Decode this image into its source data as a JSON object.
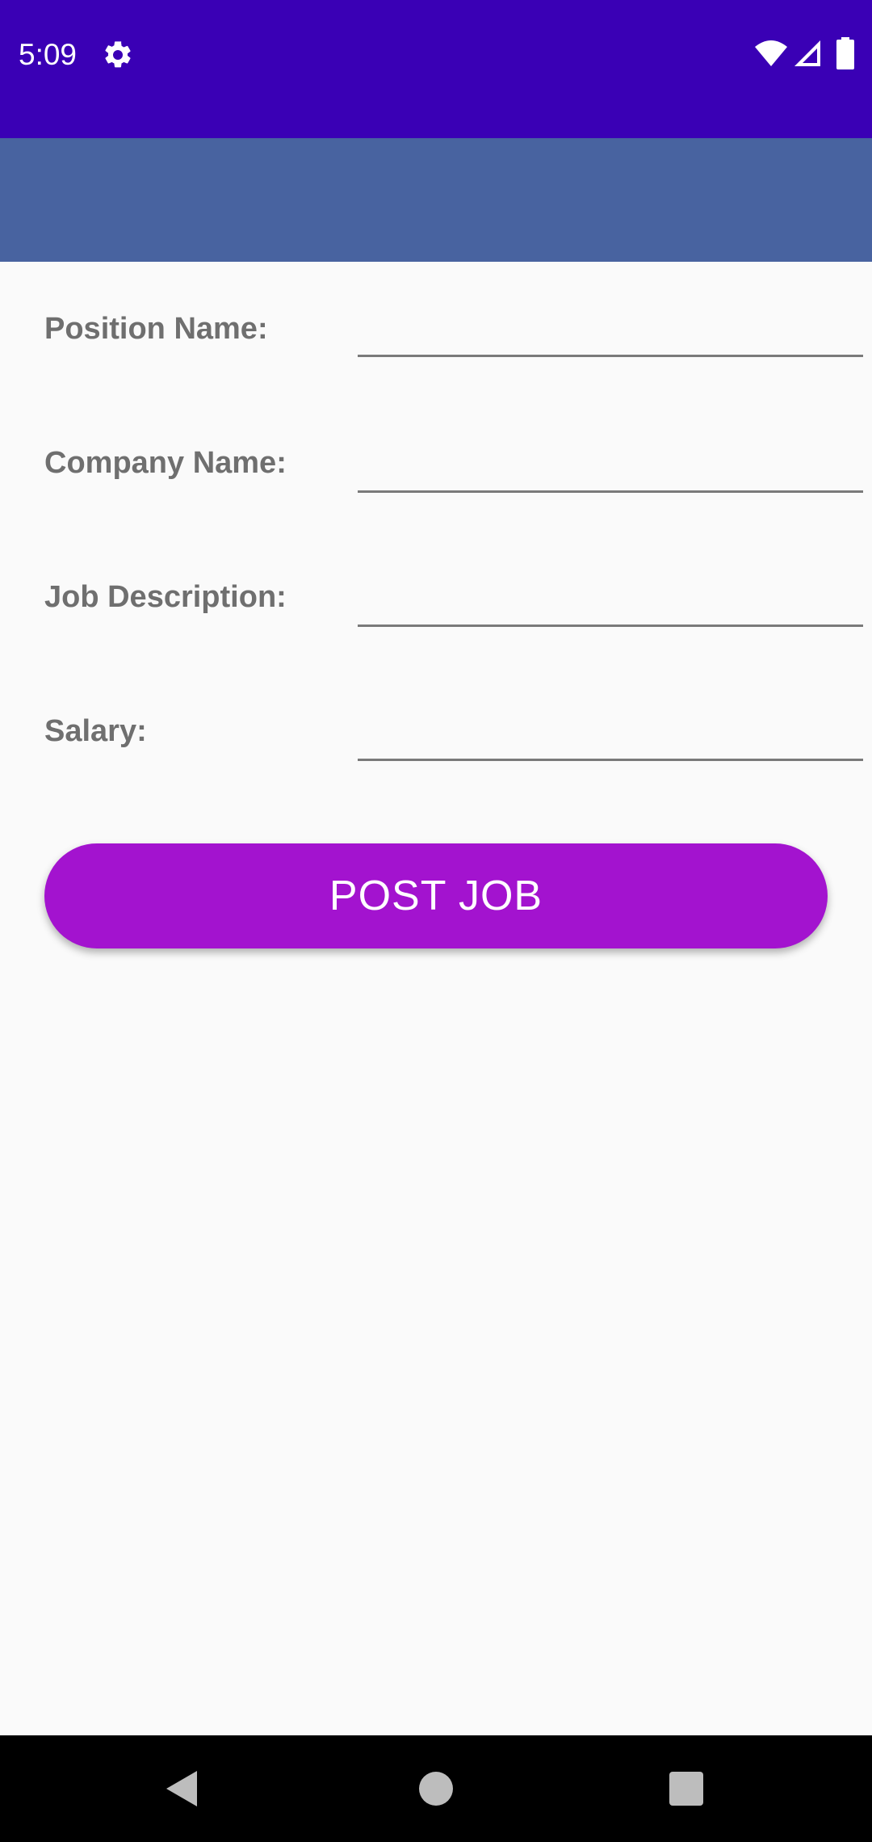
{
  "status_bar": {
    "time": "5:09",
    "icons": [
      "gear-icon",
      "wifi-icon",
      "signal-icon",
      "battery-icon"
    ],
    "background": "#3A00B5"
  },
  "app_bar": {
    "background": "#4863A0"
  },
  "form": {
    "position_label": "Position Name:",
    "position_value": "",
    "company_label": "Company Name:",
    "company_value": "",
    "description_label": "Job Description:",
    "description_value": "",
    "salary_label": "Salary:",
    "salary_value": ""
  },
  "post_button": {
    "label": "POST JOB",
    "color": "#A313CF"
  },
  "nav_bar": {
    "icons": [
      "back-icon",
      "home-icon",
      "recents-icon"
    ]
  }
}
